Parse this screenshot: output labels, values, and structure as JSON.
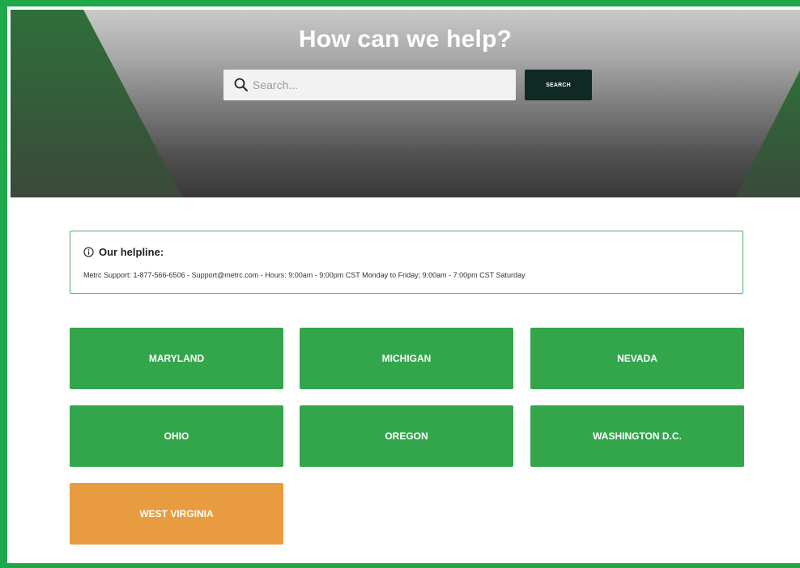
{
  "hero": {
    "title": "How can we help?",
    "search_placeholder": "Search...",
    "search_button_label": "SEARCH",
    "search_icon": "search-icon"
  },
  "helpline": {
    "icon": "info-icon",
    "title": "Our helpline:",
    "text": "Metrc Support: 1-877-566-6506 - Support@metrc.com - Hours: 9:00am - 9:00pm CST Monday to Friday; 9:00am - 7:00pm CST Saturday"
  },
  "states": [
    {
      "label": "MARYLAND"
    },
    {
      "label": "MICHIGAN"
    },
    {
      "label": "NEVADA"
    },
    {
      "label": "OHIO"
    },
    {
      "label": "OREGON"
    },
    {
      "label": "WASHINGTON D.C."
    },
    {
      "label": "WEST VIRGINIA"
    }
  ],
  "colors": {
    "frame": "#1ea84a",
    "state_tile": "#33a64c",
    "state_tile_highlight": "#e89b3f",
    "search_button": "#0f2a24",
    "helpline_border": "#4caf6a"
  }
}
